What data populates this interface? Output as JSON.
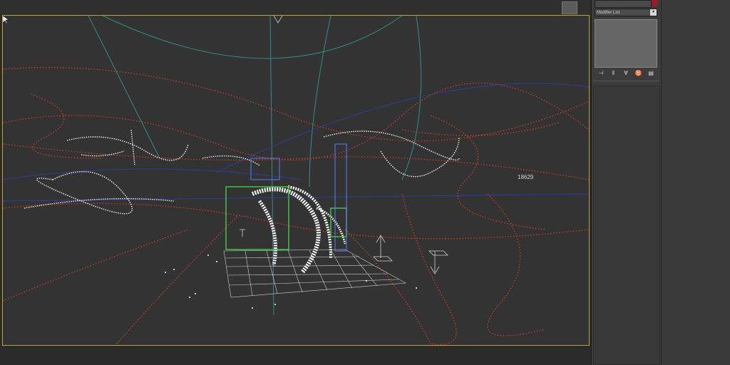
{
  "viewport": {
    "object_label": "18629"
  },
  "command_panel": {
    "modifier_list_label": "Modifier List",
    "modifier_list_arrow": "▾",
    "object_color": "#9a1a2a",
    "stack_tools": [
      {
        "icon": "pin-stack-icon",
        "glyph": "⊣"
      },
      {
        "icon": "show-end-result-icon",
        "glyph": "‖"
      },
      {
        "icon": "make-unique-icon",
        "glyph": "∀"
      },
      {
        "icon": "remove-modifier-icon",
        "glyph": "♉"
      },
      {
        "icon": "configure-modifier-sets-icon",
        "glyph": "▤"
      }
    ]
  },
  "colors": {
    "viewport_border": "#b9a53a",
    "trail_red": "#c8402a",
    "trail_white": "#f2f2f2",
    "gizmo_green": "#3fc43f",
    "gizmo_blue": "#5a7dff",
    "grid_teal": "#2f8f88"
  }
}
